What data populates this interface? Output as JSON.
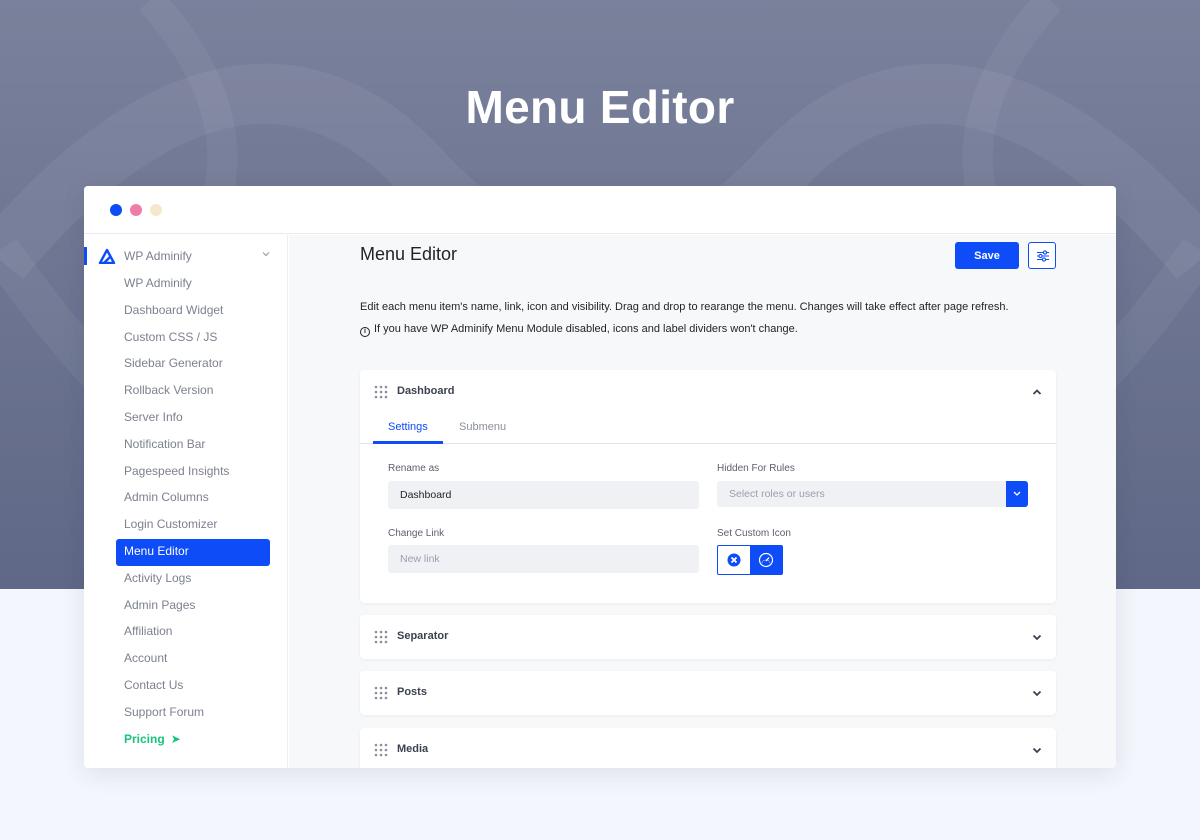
{
  "hero": {
    "title": "Menu Editor"
  },
  "colors": {
    "accent": "#0d4cf7",
    "pricing": "#19c37d",
    "hero_bg": "#6b7390",
    "page_bg": "#f3f6fc"
  },
  "sidebar": {
    "plugin": {
      "label": "WP Adminify",
      "icon": "adminify-logo-icon"
    },
    "items": [
      {
        "label": "WP Adminify"
      },
      {
        "label": "Dashboard Widget"
      },
      {
        "label": "Custom CSS / JS"
      },
      {
        "label": "Sidebar Generator"
      },
      {
        "label": "Rollback Version"
      },
      {
        "label": "Server Info"
      },
      {
        "label": "Notification Bar"
      },
      {
        "label": "Pagespeed Insights"
      },
      {
        "label": "Admin Columns"
      },
      {
        "label": "Login Customizer"
      },
      {
        "label": "Menu Editor",
        "active": true
      },
      {
        "label": "Activity Logs"
      },
      {
        "label": "Admin Pages"
      },
      {
        "label": "Affiliation"
      },
      {
        "label": "Account"
      },
      {
        "label": "Contact Us"
      },
      {
        "label": "Support Forum"
      },
      {
        "label": "Pricing",
        "icon": "send-arrow-icon"
      }
    ]
  },
  "main": {
    "title": "Menu Editor",
    "save_label": "Save",
    "settings_icon": "sliders-icon",
    "description": "Edit each menu item's name, link, icon and visibility. Drag and drop to rearange the menu. Changes will take effect after page refresh.",
    "notice": "If you have WP Adminify Menu Module disabled, icons and label dividers won't change.",
    "notice_icon": "info-icon",
    "menu_items": [
      {
        "name": "Dashboard",
        "expanded": true,
        "tabs": [
          "Settings",
          "Submenu"
        ],
        "active_tab": "Settings",
        "rename_label": "Rename as",
        "rename_value": "Dashboard",
        "hidden_label": "Hidden For Rules",
        "hidden_placeholder": "Select roles or users",
        "link_label": "Change Link",
        "link_placeholder": "New link",
        "icon_label": "Set Custom Icon",
        "current_icon": "dashboard-gauge-icon"
      },
      {
        "name": "Separator",
        "expanded": false
      },
      {
        "name": "Posts",
        "expanded": false
      },
      {
        "name": "Media",
        "expanded": false
      }
    ]
  }
}
